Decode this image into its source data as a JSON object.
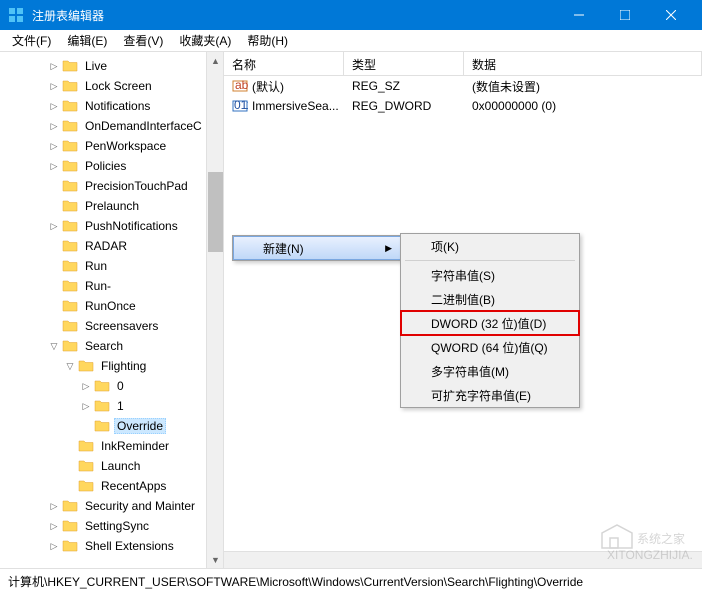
{
  "window": {
    "title": "注册表编辑器"
  },
  "menu": {
    "file": "文件(F)",
    "edit": "编辑(E)",
    "view": "查看(V)",
    "favorites": "收藏夹(A)",
    "help": "帮助(H)"
  },
  "tree": {
    "items": [
      {
        "indent": 48,
        "chev": ">",
        "label": "Live"
      },
      {
        "indent": 48,
        "chev": ">",
        "label": "Lock Screen"
      },
      {
        "indent": 48,
        "chev": ">",
        "label": "Notifications"
      },
      {
        "indent": 48,
        "chev": ">",
        "label": "OnDemandInterfaceC"
      },
      {
        "indent": 48,
        "chev": ">",
        "label": "PenWorkspace"
      },
      {
        "indent": 48,
        "chev": ">",
        "label": "Policies"
      },
      {
        "indent": 48,
        "chev": "",
        "label": "PrecisionTouchPad"
      },
      {
        "indent": 48,
        "chev": "",
        "label": "Prelaunch"
      },
      {
        "indent": 48,
        "chev": ">",
        "label": "PushNotifications"
      },
      {
        "indent": 48,
        "chev": "",
        "label": "RADAR"
      },
      {
        "indent": 48,
        "chev": "",
        "label": "Run"
      },
      {
        "indent": 48,
        "chev": "",
        "label": "Run-"
      },
      {
        "indent": 48,
        "chev": "",
        "label": "RunOnce"
      },
      {
        "indent": 48,
        "chev": "",
        "label": "Screensavers"
      },
      {
        "indent": 48,
        "chev": "v",
        "label": "Search"
      },
      {
        "indent": 64,
        "chev": "v",
        "label": "Flighting"
      },
      {
        "indent": 80,
        "chev": ">",
        "label": "0"
      },
      {
        "indent": 80,
        "chev": ">",
        "label": "1"
      },
      {
        "indent": 80,
        "chev": "",
        "label": "Override",
        "selected": true
      },
      {
        "indent": 64,
        "chev": "",
        "label": "InkReminder"
      },
      {
        "indent": 64,
        "chev": "",
        "label": "Launch"
      },
      {
        "indent": 64,
        "chev": "",
        "label": "RecentApps"
      },
      {
        "indent": 48,
        "chev": ">",
        "label": "Security and Mainter"
      },
      {
        "indent": 48,
        "chev": ">",
        "label": "SettingSync"
      },
      {
        "indent": 48,
        "chev": ">",
        "label": "Shell Extensions"
      }
    ]
  },
  "list": {
    "headers": {
      "name": "名称",
      "type": "类型",
      "data": "数据"
    },
    "rows": [
      {
        "icon": "string",
        "name": "(默认)",
        "type": "REG_SZ",
        "data": "(数值未设置)"
      },
      {
        "icon": "binary",
        "name": "ImmersiveSea...",
        "type": "REG_DWORD",
        "data": "0x00000000 (0)"
      }
    ]
  },
  "context": {
    "new": "新建(N)"
  },
  "submenu": {
    "key": "项(K)",
    "string": "字符串值(S)",
    "binary": "二进制值(B)",
    "dword32": "DWORD (32 位)值(D)",
    "qword64": "QWORD (64 位)值(Q)",
    "multistring": "多字符串值(M)",
    "expandstring": "可扩充字符串值(E)"
  },
  "statusbar": {
    "path": "计算机\\HKEY_CURRENT_USER\\SOFTWARE\\Microsoft\\Windows\\CurrentVersion\\Search\\Flighting\\Override"
  },
  "watermark": {
    "text": "系统之家"
  }
}
